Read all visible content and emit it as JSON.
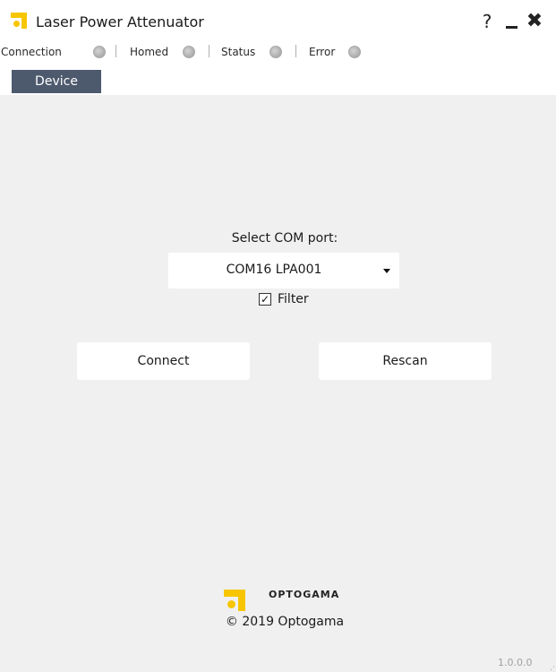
{
  "window": {
    "title": "Laser Power Attenuator",
    "help_label": "?",
    "close_label": "✖",
    "logo_color": "#f7c600"
  },
  "status": {
    "connection": "Connection",
    "homed": "Homed",
    "status": "Status",
    "error": "Error",
    "led_color": "#b5b5b5"
  },
  "tabs": [
    {
      "label": "Device",
      "active": true
    }
  ],
  "tab_color": "#4d5a6e",
  "device": {
    "select_label": "Select COM port:",
    "com_value": "COM16 LPA001",
    "filter_label": "Filter",
    "filter_checked": true,
    "connect_label": "Connect",
    "rescan_label": "Rescan"
  },
  "footer": {
    "brand": "OPTOGAMA",
    "copyright": "© 2019 Optogama",
    "version": "1.0.0.0"
  }
}
